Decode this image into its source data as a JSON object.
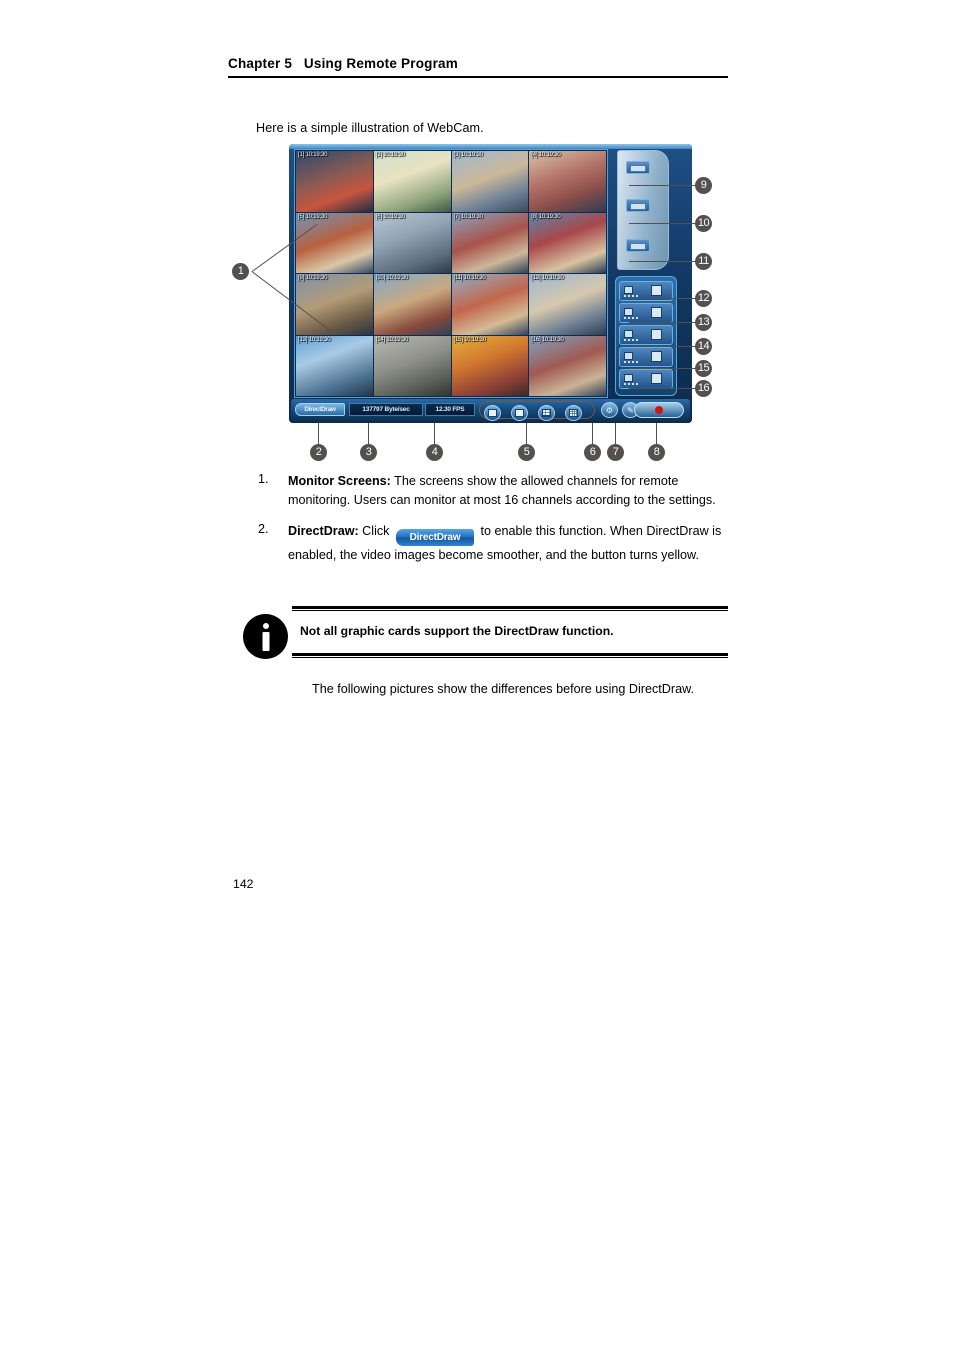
{
  "header": {
    "chapter_title": "Chapter 5   Using Remote Program"
  },
  "intro": "Here is a simple illustration of WebCam.",
  "figure": {
    "app": {
      "channels": [
        {
          "label": "[1] 10:19:30",
          "selected": true
        },
        {
          "label": "[2] 10:19:30",
          "selected": false
        },
        {
          "label": "[3] 10:19:30",
          "selected": false
        },
        {
          "label": "[4] 10:19:30",
          "selected": false
        },
        {
          "label": "[5] 10:19:30",
          "selected": false
        },
        {
          "label": "[6] 10:19:30",
          "selected": false
        },
        {
          "label": "[7] 10:19:30",
          "selected": false
        },
        {
          "label": "[8] 10:19:30",
          "selected": false
        },
        {
          "label": "[9] 10:19:30",
          "selected": false
        },
        {
          "label": "[10] 10:19:30",
          "selected": false
        },
        {
          "label": "[11] 10:19:30",
          "selected": false
        },
        {
          "label": "[12] 10:19:30",
          "selected": false
        },
        {
          "label": "[13] 10:19:30",
          "selected": false
        },
        {
          "label": "[14] 10:19:30",
          "selected": false
        },
        {
          "label": "[15] 10:19:30",
          "selected": false
        },
        {
          "label": "[16] 10:19:30",
          "selected": false
        }
      ],
      "toolbar": {
        "directdraw_label": "DirectDraw",
        "bitrate": "137797 Byte/sec",
        "fps": "12.30 FPS",
        "view_buttons": [
          "single-view",
          "quad-view",
          "nine-view",
          "sixteen-view"
        ],
        "extra_buttons": [
          "settings-icon",
          "pen-icon"
        ],
        "record_button": "record-button"
      },
      "sidebar": {
        "top_buttons": [
          "sidebar-top-button-1",
          "sidebar-top-button-2",
          "sidebar-top-button-3"
        ],
        "panel_buttons": [
          "sidebar-panel-button-1",
          "sidebar-panel-button-2",
          "sidebar-panel-button-3",
          "sidebar-panel-button-4",
          "sidebar-panel-button-5"
        ]
      },
      "accent_colors": {
        "frame_navy": "#123a67",
        "frame_light_blue": "#4fa3dd",
        "selection_red": "#c21b17",
        "record_red": "#cf1414",
        "directdraw_blue": "#2a6aa6"
      }
    },
    "callouts": [
      {
        "n": "1"
      },
      {
        "n": "2"
      },
      {
        "n": "3"
      },
      {
        "n": "4"
      },
      {
        "n": "5"
      },
      {
        "n": "6"
      },
      {
        "n": "7"
      },
      {
        "n": "8"
      },
      {
        "n": "9"
      },
      {
        "n": "10"
      },
      {
        "n": "11"
      },
      {
        "n": "12"
      },
      {
        "n": "13"
      },
      {
        "n": "14"
      },
      {
        "n": "15"
      },
      {
        "n": "16"
      }
    ]
  },
  "list": {
    "item1": {
      "num": "1.",
      "term": "Monitor Screens:",
      "body": " The screens show the allowed channels for remote monitoring. Users can monitor at most 16 channels according to the settings."
    },
    "item2": {
      "num": "2.",
      "term": "DirectDraw:",
      "pre": " Click ",
      "button_label": "DirectDraw",
      "post": " to enable this function. When DirectDraw is enabled, the video images become smoother, and the button turns yellow."
    }
  },
  "note": {
    "text": "Not all graphic cards support the DirectDraw function."
  },
  "after_note": "The following pictures show the differences before using DirectDraw.",
  "page_number": "142"
}
